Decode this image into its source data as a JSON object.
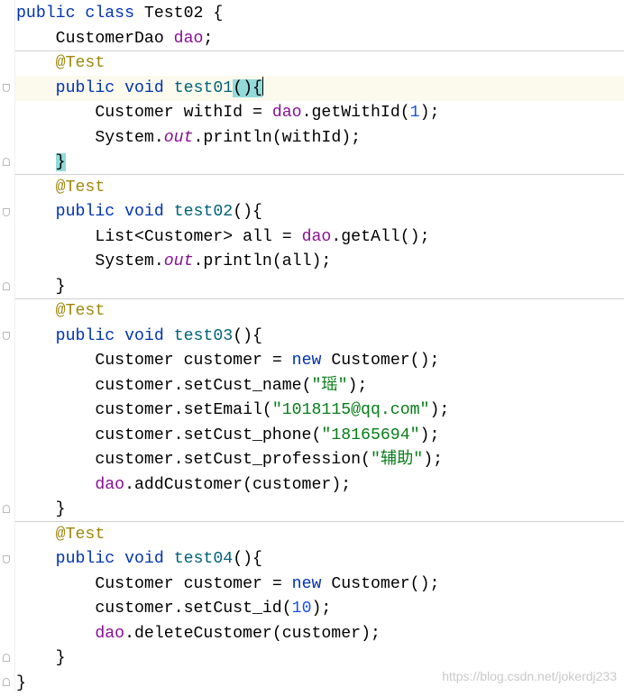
{
  "editor": {
    "language": "Java",
    "colors": {
      "keyword": "#0033b3",
      "field": "#871094",
      "annotation": "#9e880d",
      "number": "#1750eb",
      "string": "#067d17",
      "method_decl": "#00627a",
      "brace_highlight": "#93d9d9",
      "current_line": "#fcfaed"
    },
    "lines": [
      "public class Test02 {",
      "    CustomerDao dao;",
      "    @Test",
      "    public void test01(){",
      "        Customer withId = dao.getWithId(1);",
      "        System.out.println(withId);",
      "    }",
      "    @Test",
      "    public void test02(){",
      "        List<Customer> all = dao.getAll();",
      "        System.out.println(all);",
      "    }",
      "    @Test",
      "    public void test03(){",
      "        Customer customer = new Customer();",
      "        customer.setCust_name(\"瑶\");",
      "        customer.setEmail(\"1018115@qq.com\");",
      "        customer.setCust_phone(\"18165694\");",
      "        customer.setCust_profession(\"辅助\");",
      "        dao.addCustomer(customer);",
      "    }",
      "    @Test",
      "    public void test04(){",
      "        Customer customer = new Customer();",
      "        customer.setCust_id(10);",
      "        dao.deleteCustomer(customer);",
      "    }",
      "}"
    ],
    "tokens": {
      "kw_public": "public",
      "kw_class": "class",
      "kw_void": "void",
      "kw_new": "new",
      "class_name": "Test02",
      "type_customer_dao": "CustomerDao",
      "type_customer": "Customer",
      "type_list_customer": "List<Customer>",
      "type_system": "System",
      "field_dao": "dao",
      "field_out": "out",
      "annotation": "@Test",
      "method_test01": "test01",
      "method_test02": "test02",
      "method_test03": "test03",
      "method_test04": "test04",
      "var_with_id": "withId",
      "var_all": "all",
      "var_customer": "customer",
      "call_get_with_id": "getWithId",
      "call_get_all": "getAll",
      "call_println": "println",
      "call_set_cust_name": "setCust_name",
      "call_set_email": "setEmail",
      "call_set_cust_phone": "setCust_phone",
      "call_set_cust_profession": "setCust_profession",
      "call_add_customer": "addCustomer",
      "call_set_cust_id": "setCust_id",
      "call_delete_customer": "deleteCustomer",
      "num_1": "1",
      "num_10": "10",
      "str_name": "\"瑶\"",
      "str_email": "\"1018115@qq.com\"",
      "str_phone": "\"18165694\"",
      "str_profession": "\"辅助\""
    }
  },
  "watermark": "https://blog.csdn.net/jokerdj233"
}
